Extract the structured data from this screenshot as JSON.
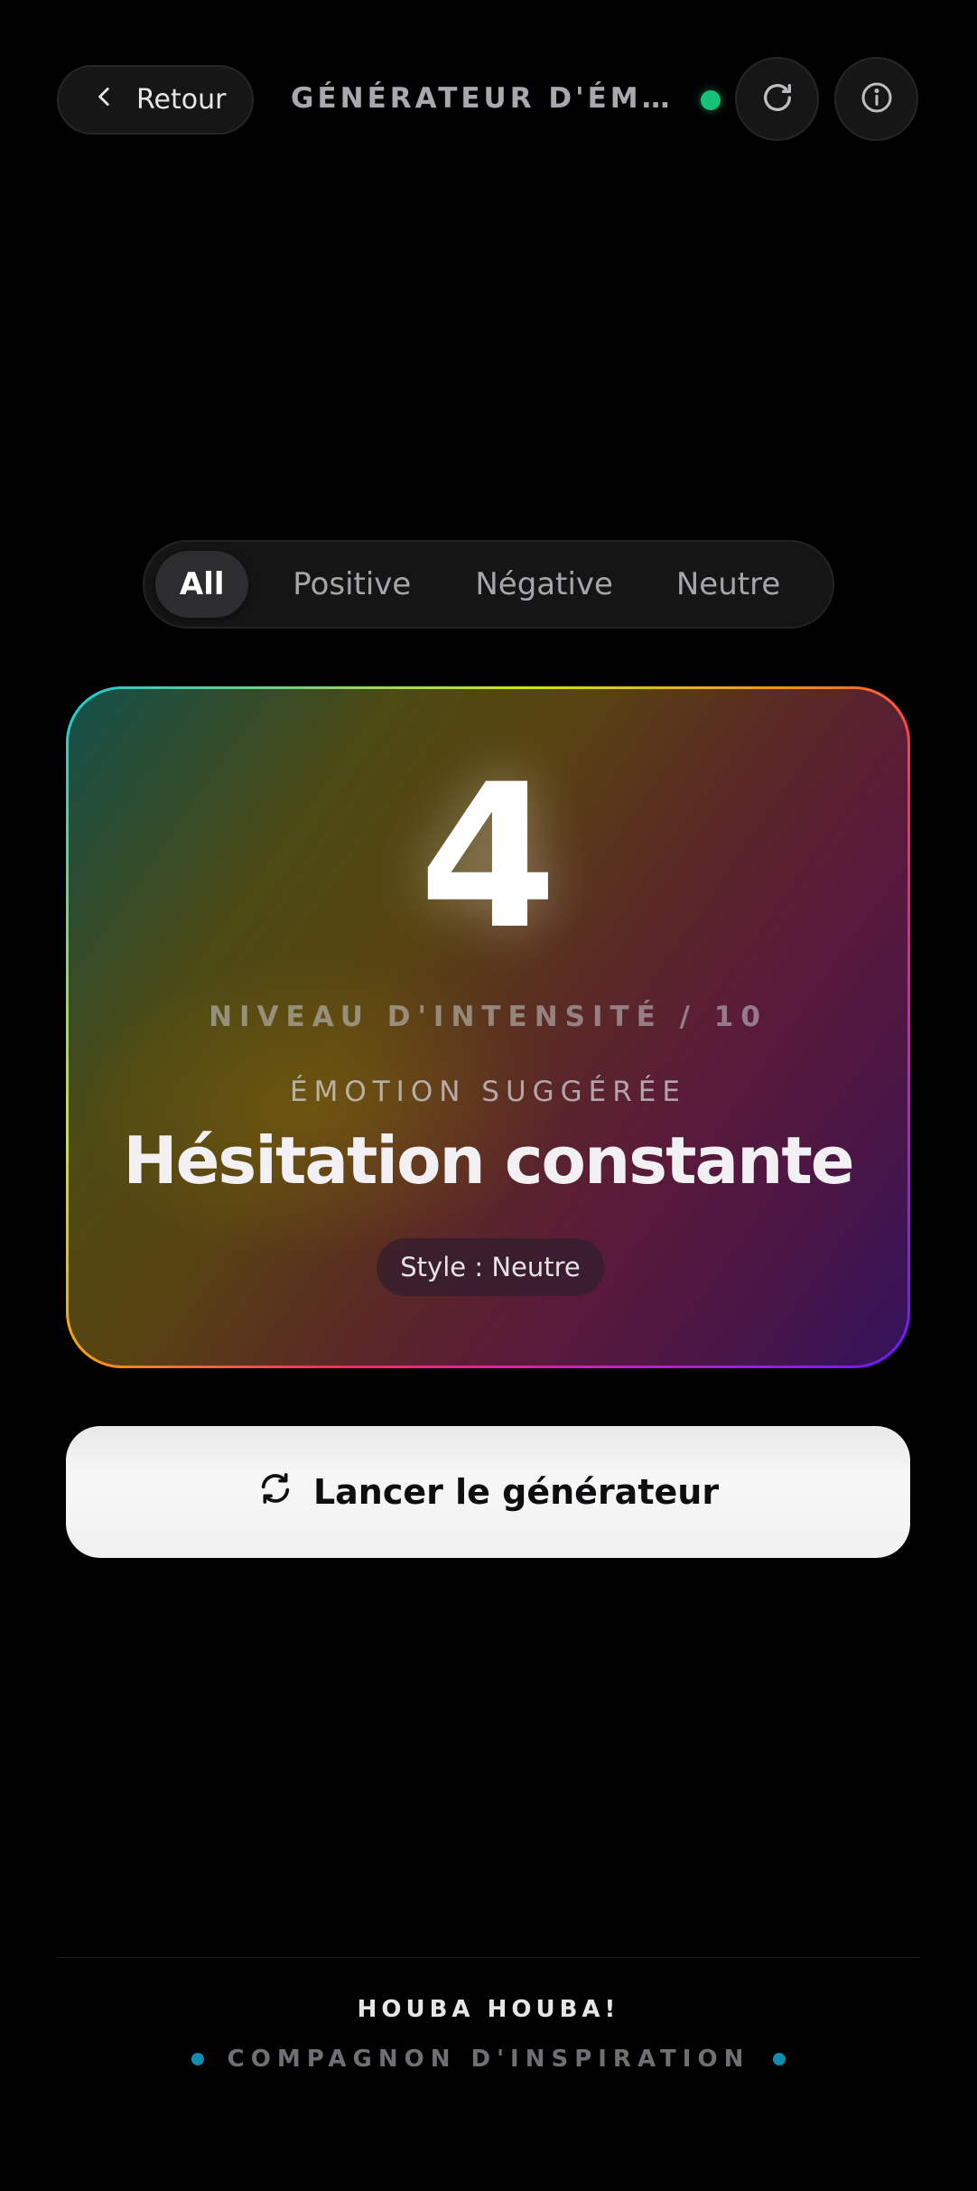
{
  "header": {
    "back_label": "Retour",
    "title": "GÉNÉRATEUR D'ÉM…",
    "status_color": "#16c27a"
  },
  "tabs": [
    {
      "label": "All",
      "active": true
    },
    {
      "label": "Positive",
      "active": false
    },
    {
      "label": "Négative",
      "active": false
    },
    {
      "label": "Neutre",
      "active": false
    }
  ],
  "card": {
    "intensity": "4",
    "intensity_label": "NIVEAU D'INTENSITÉ / 10",
    "emotion_label": "ÉMOTION SUGGÉRÉE",
    "emotion": "Hésitation constante",
    "style": "Style : Neutre"
  },
  "generate_button": {
    "label": "Lancer le générateur",
    "icon": "refresh-icon"
  },
  "footer": {
    "brand": "HOUBA HOUBA!",
    "tagline": "COMPAGNON D'INSPIRATION",
    "accent": "#0e8fb0"
  },
  "icons": {
    "back": "chevron-left-icon",
    "refresh": "refresh-icon",
    "info": "info-icon"
  }
}
